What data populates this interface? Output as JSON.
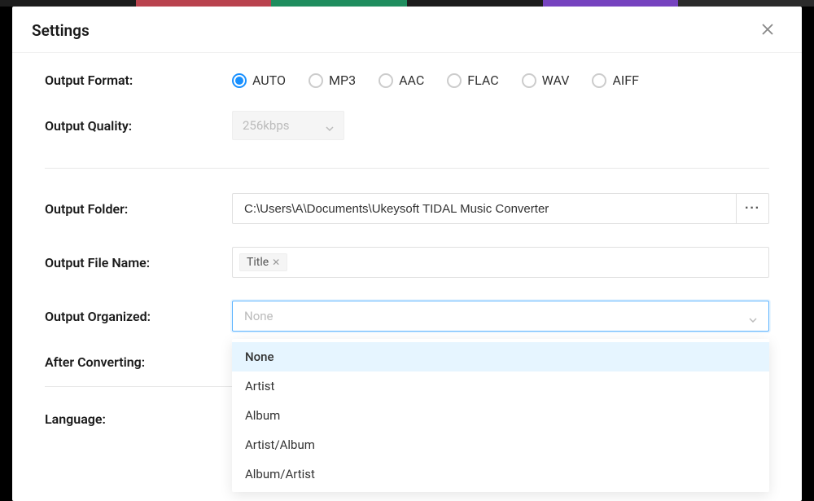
{
  "title": "Settings",
  "labels": {
    "output_format": "Output Format:",
    "output_quality": "Output Quality:",
    "output_folder": "Output Folder:",
    "output_file_name": "Output File Name:",
    "output_organized": "Output Organized:",
    "after_converting": "After Converting:",
    "language": "Language:"
  },
  "format_options": [
    "AUTO",
    "MP3",
    "AAC",
    "FLAC",
    "WAV",
    "AIFF"
  ],
  "format_selected": "AUTO",
  "quality_value": "256kbps",
  "folder_value": "C:\\Users\\A\\Documents\\Ukeysoft TIDAL Music Converter",
  "browse_button": "···",
  "filename_tag": "Title",
  "organized_value": "None",
  "organized_options": [
    "None",
    "Artist",
    "Album",
    "Artist/Album",
    "Album/Artist"
  ],
  "organized_selected": "None"
}
